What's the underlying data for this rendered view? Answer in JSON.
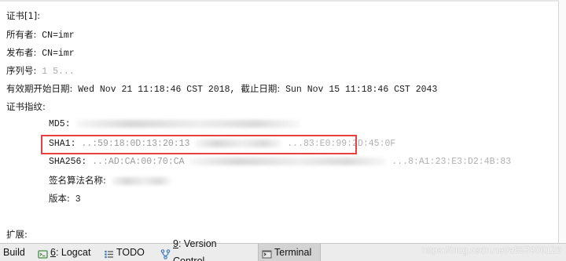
{
  "console": {
    "cert_header": "证书[1]:",
    "owner_label": "所有者:",
    "owner_value": "CN=imr",
    "issuer_label": "发布者:",
    "issuer_value": "CN=imr",
    "serial_label": "序列号:",
    "serial_value": "1 5...",
    "validity_label": "有效期开始日期:",
    "validity_start": "Wed Nov 21 11:18:46 CST 2018,",
    "validity_end_label": "截止日期:",
    "validity_end": "Sun Nov 15 11:18:46 CST 2043",
    "fingerprint_label": "证书指纹:",
    "md5_label": "MD5:",
    "md5_value": "...",
    "sha1_label": "SHA1:",
    "sha1_value": "..:59:18:0D:13:20:13",
    "sha1_tail": "...83:E0:99:2D:45:0F",
    "sha256_label": "SHA256:",
    "sha256_value": "..:AD:CA:00:70:CA",
    "sha256_tail": "...8:A1:23:E3:D2:4B:83",
    "sig_alg_label": "签名算法名称:",
    "sig_alg_value": "...",
    "version_label": "版本:",
    "version_value": "3",
    "extensions_label": "扩展:"
  },
  "toolbar": {
    "build": "Build",
    "logcat_num": "6",
    "logcat": ": Logcat",
    "todo": "TODO",
    "vc_num": "9",
    "vc": ": Version Control",
    "terminal": "Terminal"
  },
  "watermark": "https://blog.csdn.net/a853906126",
  "colors": {
    "highlight": "#e8403e",
    "toolbar_bg": "#ececec",
    "active_tab": "#d3d3d3",
    "logcat_icon": "#4a8a4a",
    "todo_icon": "#3b7bbf",
    "vc_icon": "#3b7bbf"
  }
}
